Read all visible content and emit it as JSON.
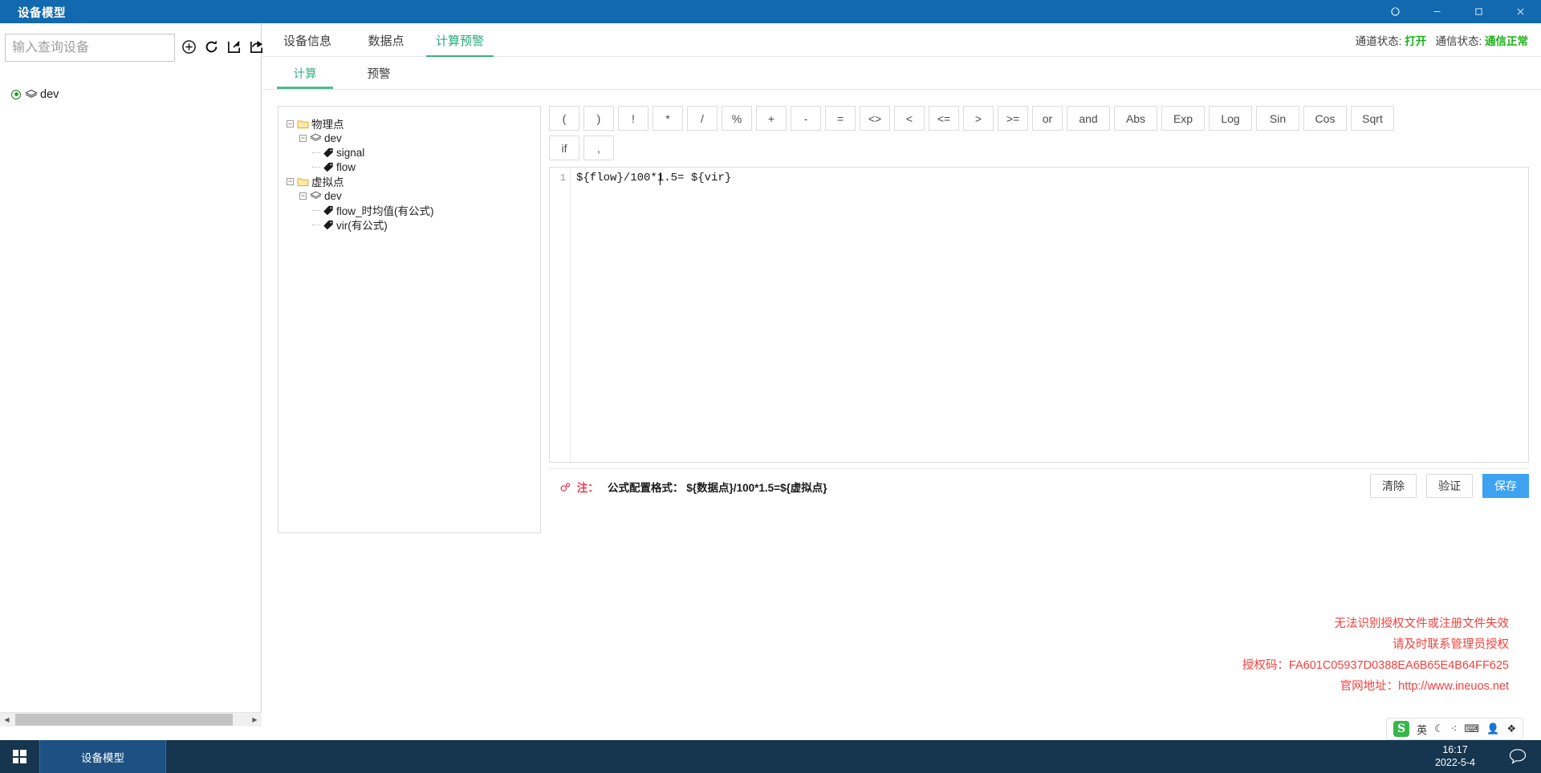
{
  "window": {
    "title": "设备模型",
    "buttons": [
      {
        "name": "restore-session-button",
        "glyph": "⟳"
      },
      {
        "name": "minimize-button",
        "glyph": "—"
      },
      {
        "name": "maximize-button",
        "glyph": "❐"
      },
      {
        "name": "close-button",
        "glyph": "✕"
      }
    ]
  },
  "left_panel": {
    "search": {
      "placeholder": "输入查询设备",
      "value": ""
    },
    "tools": [
      {
        "name": "add-device-icon",
        "title": "新增"
      },
      {
        "name": "refresh-icon",
        "title": "刷新"
      },
      {
        "name": "import-icon",
        "title": "导入"
      },
      {
        "name": "export-icon",
        "title": "导出"
      }
    ],
    "device_tree": [
      {
        "label": "dev",
        "selected": true
      }
    ]
  },
  "header": {
    "tabs": [
      {
        "label": "设备信息",
        "active": false
      },
      {
        "label": "数据点",
        "active": false
      },
      {
        "label": "计算预警",
        "active": true
      }
    ],
    "status": {
      "channel_label": "通道状态:",
      "channel_value": "打开",
      "comm_label": "通信状态:",
      "comm_value": "通信正常"
    }
  },
  "sub_tabs": [
    {
      "label": "计算",
      "active": true
    },
    {
      "label": "预警",
      "active": false
    }
  ],
  "point_tree": [
    {
      "depth": 0,
      "icon": "folder",
      "label": "物理点",
      "expander": "−"
    },
    {
      "depth": 1,
      "icon": "device",
      "label": "dev",
      "expander": "−"
    },
    {
      "depth": 2,
      "icon": "tag",
      "label": "signal",
      "expander": ""
    },
    {
      "depth": 2,
      "icon": "tag",
      "label": "flow",
      "expander": ""
    },
    {
      "depth": 0,
      "icon": "folder",
      "label": "虚拟点",
      "expander": "−"
    },
    {
      "depth": 1,
      "icon": "device",
      "label": "dev",
      "expander": "−"
    },
    {
      "depth": 2,
      "icon": "tag",
      "label": "flow_时均值(有公式)",
      "expander": ""
    },
    {
      "depth": 2,
      "icon": "tag",
      "label": "vir(有公式)",
      "expander": ""
    }
  ],
  "operators": {
    "row1": [
      "(",
      ")",
      "!",
      "*",
      "/",
      "%",
      "+",
      "-",
      "=",
      "<>",
      "<",
      "<=",
      ">",
      ">=",
      "or",
      "and",
      "Abs",
      "Exp",
      "Log",
      "Sin",
      "Cos",
      "Sqrt"
    ],
    "row2": [
      "if",
      ","
    ]
  },
  "editor": {
    "line_number": "1",
    "formula": "${flow}/100*1.5= ${vir}"
  },
  "footer": {
    "note_tag": "注：",
    "note_label": "公式配置格式：",
    "note_format": "${数据点}/100*1.5=${虚拟点}",
    "buttons": [
      {
        "name": "clear-button",
        "label": "清除",
        "primary": false
      },
      {
        "name": "validate-button",
        "label": "验证",
        "primary": false
      },
      {
        "name": "save-button",
        "label": "保存",
        "primary": true
      }
    ]
  },
  "license_warning": {
    "line1": "无法识别授权文件或注册文件失效",
    "line2": "请及时联系管理员授权",
    "line3": "授权码：FA601C05937D0388EA6B65E4B64FF625",
    "line4": "官网地址：http://www.ineuos.net",
    "color": "#f5403c"
  },
  "ime_tray": {
    "logo": "S",
    "items": [
      "英",
      "☾",
      "⁖",
      "⌨",
      "👤",
      "❖"
    ]
  },
  "taskbar": {
    "start": "windows-logo",
    "items": [
      {
        "label": "设备模型",
        "active": true
      }
    ],
    "clock": {
      "time": "16:17",
      "date": "2022-5-4"
    },
    "tray": [
      {
        "name": "notification-chat-icon",
        "glyph": "💬"
      }
    ]
  },
  "colors": {
    "titlebar": "#1269b0",
    "accent_green": "#3fb27f",
    "primary_blue": "#3da3f0",
    "status_green": "#18b218",
    "warning_red": "#f5403c",
    "taskbar": "#16364f"
  }
}
